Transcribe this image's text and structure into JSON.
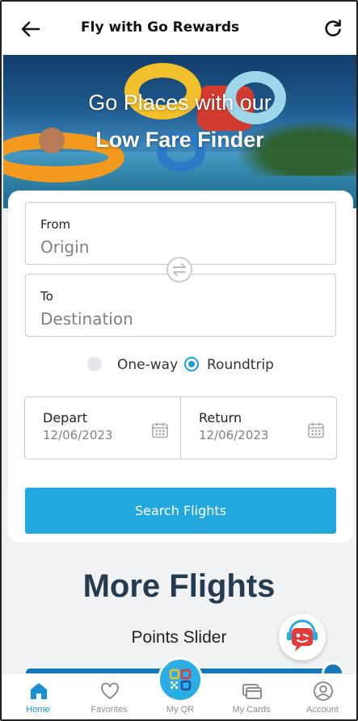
{
  "header": {
    "title": "Fly with Go Rewards"
  },
  "hero": {
    "line1": "Go Places with our",
    "line2": "Low Fare Finder"
  },
  "search": {
    "from_label": "From",
    "from_placeholder": "Origin",
    "to_label": "To",
    "to_placeholder": "Destination",
    "trip_types": {
      "oneway": "One-way",
      "roundtrip": "Roundtrip",
      "selected": "roundtrip"
    },
    "depart_label": "Depart",
    "depart_value": "12/06/2023",
    "return_label": "Return",
    "return_value": "12/06/2023",
    "button_label": "Search Flights"
  },
  "more": {
    "title": "More Flights",
    "subtitle": "Points Slider"
  },
  "nav": {
    "home": "Home",
    "favorites": "Favorites",
    "myqr": "My QR",
    "mycards": "My Cards",
    "account": "Account"
  },
  "colors": {
    "accent": "#22a8dc",
    "nav_active": "#1c8fd0",
    "heading": "#263a50"
  }
}
